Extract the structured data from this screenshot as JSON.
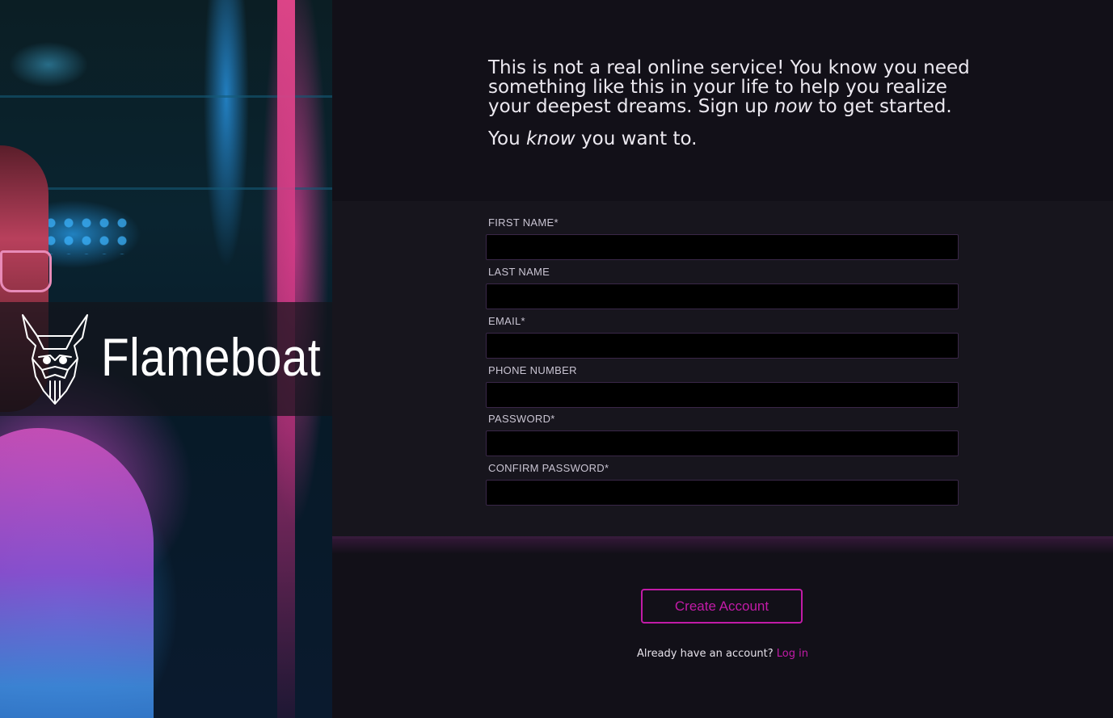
{
  "brand": {
    "name": "Flameboat",
    "logo_icon": "bearded-viking-icon"
  },
  "intro": {
    "line1_a": "This is not a real online service! You know you need something like this in your life to help you realize your deepest dreams. Sign up ",
    "line1_em": "now",
    "line1_b": " to get started.",
    "line2_a": "You ",
    "line2_em": "know",
    "line2_b": " you want to."
  },
  "form": {
    "fields": [
      {
        "label": "FIRST NAME*",
        "value": "",
        "placeholder": ""
      },
      {
        "label": "LAST NAME",
        "value": "",
        "placeholder": ""
      },
      {
        "label": "EMAIL*",
        "value": "",
        "placeholder": ""
      },
      {
        "label": "PHONE NUMBER",
        "value": "",
        "placeholder": ""
      },
      {
        "label": "PASSWORD*",
        "value": "",
        "placeholder": ""
      },
      {
        "label": "CONFIRM PASSWORD*",
        "value": "",
        "placeholder": ""
      }
    ],
    "submit_label": "Create Account",
    "login_prompt": "Already have an account? ",
    "login_link": "Log in"
  },
  "colors": {
    "accent": "#c21ba7",
    "background": "#121018",
    "form_background": "#17151d",
    "input_background": "#000000"
  }
}
